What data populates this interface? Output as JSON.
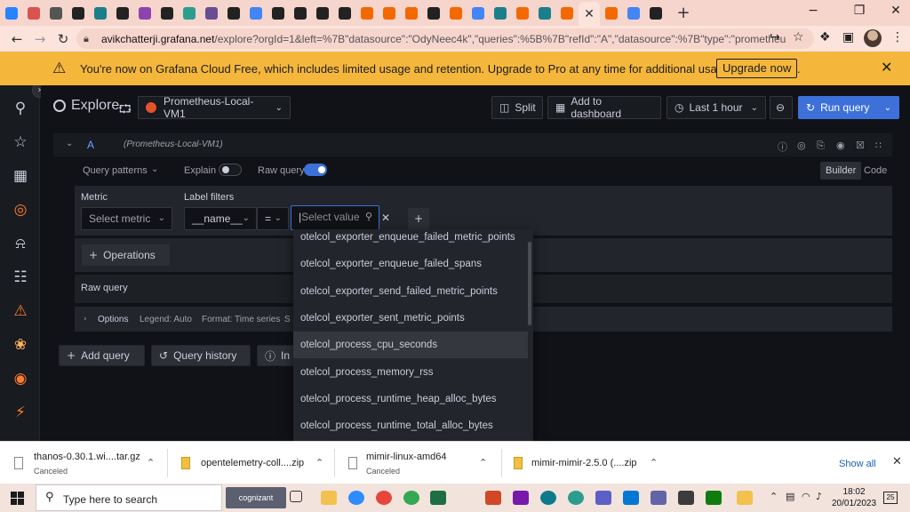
{
  "browser": {
    "tabs": [
      {
        "icon": "atlassian-icon",
        "color": "#2684ff"
      },
      {
        "icon": "grid-icon",
        "color": "#d9534f"
      },
      {
        "icon": "settings-icon",
        "color": "#555"
      },
      {
        "icon": "github-icon",
        "color": "#222"
      },
      {
        "icon": "page-icon",
        "color": "#1a7f8a"
      },
      {
        "icon": "1c-icon",
        "color": "#222"
      },
      {
        "icon": "doc-icon",
        "color": "#8e44ad"
      },
      {
        "icon": "github-icon",
        "color": "#222"
      },
      {
        "icon": "image-icon",
        "color": "#2a9d8f"
      },
      {
        "icon": "puzzle-icon",
        "color": "#6a4c93"
      },
      {
        "icon": "github-icon",
        "color": "#222"
      },
      {
        "icon": "google-icon",
        "color": "#4285f4"
      },
      {
        "icon": "github-icon",
        "color": "#222"
      },
      {
        "icon": "github-icon",
        "color": "#222"
      },
      {
        "icon": "github-icon",
        "color": "#222"
      },
      {
        "icon": "github-icon",
        "color": "#222"
      },
      {
        "icon": "grafana-icon",
        "color": "#f46800"
      },
      {
        "icon": "grafana-icon",
        "color": "#f46800"
      },
      {
        "icon": "grafana-icon",
        "color": "#f46800"
      },
      {
        "icon": "github-icon",
        "color": "#222"
      },
      {
        "icon": "grafana-icon",
        "color": "#f46800"
      },
      {
        "icon": "google-icon",
        "color": "#4285f4"
      },
      {
        "icon": "page-icon",
        "color": "#1a7f8a"
      },
      {
        "icon": "grafana-icon",
        "color": "#f46800"
      },
      {
        "icon": "page-icon",
        "color": "#1a7f8a"
      },
      {
        "icon": "grafana-icon",
        "color": "#f46800"
      },
      {
        "icon": "grafana-icon",
        "color": "#f46800",
        "active": true
      },
      {
        "icon": "grafana-icon",
        "color": "#f46800"
      },
      {
        "icon": "google-icon",
        "color": "#4285f4"
      },
      {
        "icon": "github-icon",
        "color": "#222"
      }
    ],
    "url_host": "avikchatterji.grafana.net",
    "url_path": "/explore?orgId=1&left=%7B\"datasource\":\"OdyNeec4k\",\"queries\":%5B%7B\"refId\":\"A\",\"datasource\":%7B\"type\":\"prometheus\",\"..."
  },
  "banner": {
    "message": "You're now on Grafana Cloud Free, which includes limited usage and retention. Upgrade to Pro at any time for additional usage and features.",
    "upgrade_label": "Upgrade now",
    "bg_color": "#f5b73b"
  },
  "toolbar": {
    "title": "Explore",
    "datasource": "Prometheus-Local-VM1",
    "split_label": "Split",
    "add_dashboard_label": "Add to dashboard",
    "time_range": "Last 1 hour",
    "run_query_label": "Run query",
    "accent_color": "#3d71d9"
  },
  "query": {
    "ref_id": "A",
    "datasource_hint": "(Prometheus-Local-VM1)",
    "patterns_label": "Query patterns",
    "explain_label": "Explain",
    "raw_query_label": "Raw query",
    "builder_label": "Builder",
    "code_label": "Code",
    "metric_heading": "Metric",
    "metric_placeholder": "Select metric",
    "label_filters_heading": "Label filters",
    "label_key": "__name__",
    "operator": "=",
    "value_placeholder": "Select value",
    "operations_label": "Operations",
    "raw_query_heading": "Raw query",
    "options_label": "Options",
    "legend_text": "Legend: Auto",
    "format_text": "Format: Time series",
    "format_trail": "S"
  },
  "dropdown_options": [
    "otelcol_exporter_enqueue_failed_metric_points",
    "otelcol_exporter_enqueue_failed_spans",
    "otelcol_exporter_send_failed_metric_points",
    "otelcol_exporter_sent_metric_points",
    "otelcol_process_cpu_seconds",
    "otelcol_process_memory_rss",
    "otelcol_process_runtime_heap_alloc_bytes",
    "otelcol_process_runtime_total_alloc_bytes"
  ],
  "bottom_buttons": {
    "add_query": "Add query",
    "query_history": "Query history",
    "inspector": "In"
  },
  "downloads": [
    {
      "name": "thanos-0.30.1.wi....tar.gz",
      "status": "Canceled"
    },
    {
      "name": "opentelemetry-coll....zip",
      "status": ""
    },
    {
      "name": "mimir-linux-amd64",
      "status": "Canceled"
    },
    {
      "name": "mimir-mimir-2.5.0 (....zip",
      "status": ""
    }
  ],
  "show_all_label": "Show all",
  "taskbar": {
    "search_placeholder": "Type here to search",
    "cognizant_label": "cognizant",
    "time": "18:02",
    "date": "20/01/2023",
    "notification_count": "25"
  }
}
